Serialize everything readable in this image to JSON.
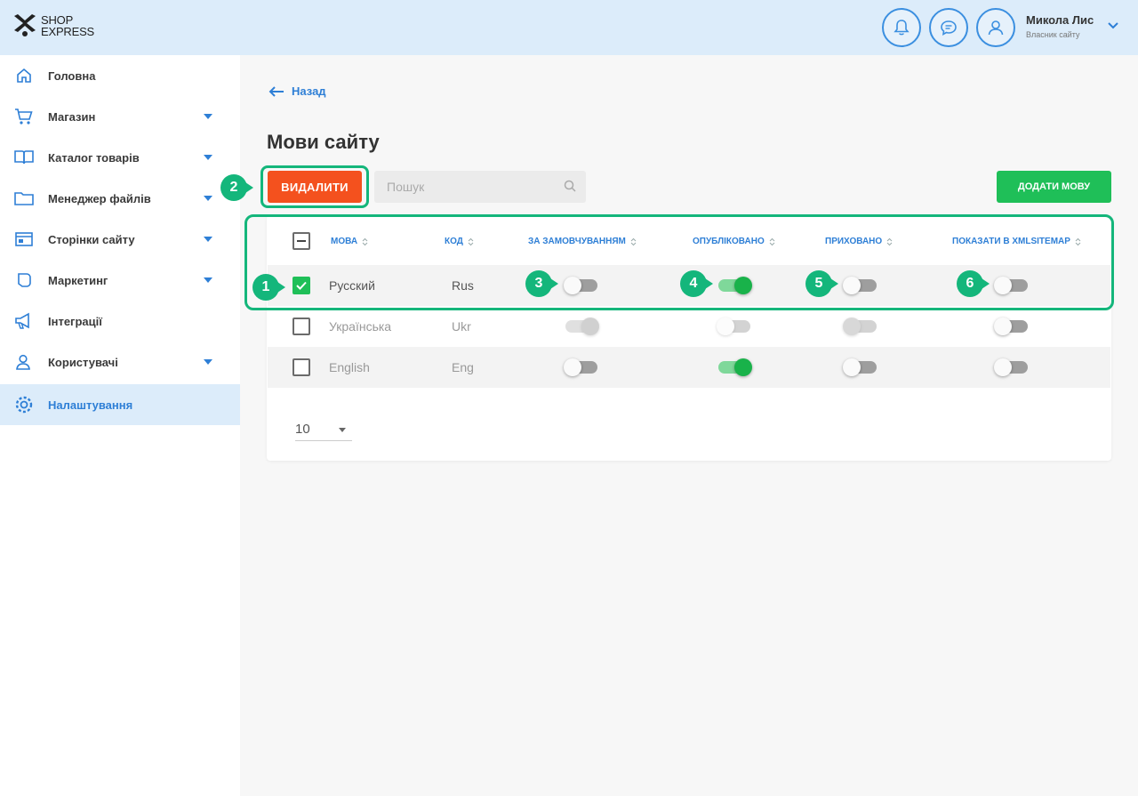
{
  "header": {
    "logo_line1": "SHOP",
    "logo_line2": "EXPRESS",
    "user_name": "Микола Лис",
    "user_role": "Власник сайту"
  },
  "sidebar": {
    "items": [
      {
        "label": "Головна",
        "icon": "home-icon",
        "has_caret": false
      },
      {
        "label": "Магазин",
        "icon": "cart-icon",
        "has_caret": true
      },
      {
        "label": "Каталог товарів",
        "icon": "book-icon",
        "has_caret": true
      },
      {
        "label": "Менеджер файлів",
        "icon": "folder-icon",
        "has_caret": true
      },
      {
        "label": "Сторінки сайту",
        "icon": "pages-icon",
        "has_caret": true
      },
      {
        "label": "Маркетинг",
        "icon": "marketing-icon",
        "has_caret": true
      },
      {
        "label": "Інтеграції",
        "icon": "megaphone-icon",
        "has_caret": false
      },
      {
        "label": "Користувачі",
        "icon": "users-icon",
        "has_caret": true
      },
      {
        "label": "Налаштування",
        "icon": "gear-icon",
        "has_caret": false,
        "active": true
      }
    ]
  },
  "main": {
    "back_label": "Назад",
    "title": "Мови сайту",
    "delete_label": "ВИДАЛИТИ",
    "search_placeholder": "Пошук",
    "add_label": "ДОДАТИ МОВУ",
    "columns": [
      "МОВА",
      "КОД",
      "ЗА ЗАМОВЧУВАННЯМ",
      "ОПУБЛІКОВАНО",
      "ПРИХОВАНО",
      "ПОКАЗАТИ В XMLSITEMAP"
    ],
    "rows": [
      {
        "name": "Русский",
        "code": "Rus",
        "selected": true,
        "default": false,
        "published": true,
        "hidden": false,
        "sitemap": false
      },
      {
        "name": "Українська",
        "code": "Ukr",
        "selected": false,
        "default": true,
        "published": false,
        "hidden": false,
        "sitemap": false
      },
      {
        "name": "English",
        "code": "Eng",
        "selected": false,
        "default": false,
        "published": true,
        "hidden": false,
        "sitemap": false
      }
    ],
    "per_page": "10"
  },
  "annotations": [
    "1",
    "2",
    "3",
    "4",
    "5",
    "6"
  ],
  "colors": {
    "accent": "#2e7fd6",
    "delete": "#f4511e",
    "add": "#1fbf58",
    "highlight": "#14b67b",
    "header_bg": "#dcecfa"
  }
}
